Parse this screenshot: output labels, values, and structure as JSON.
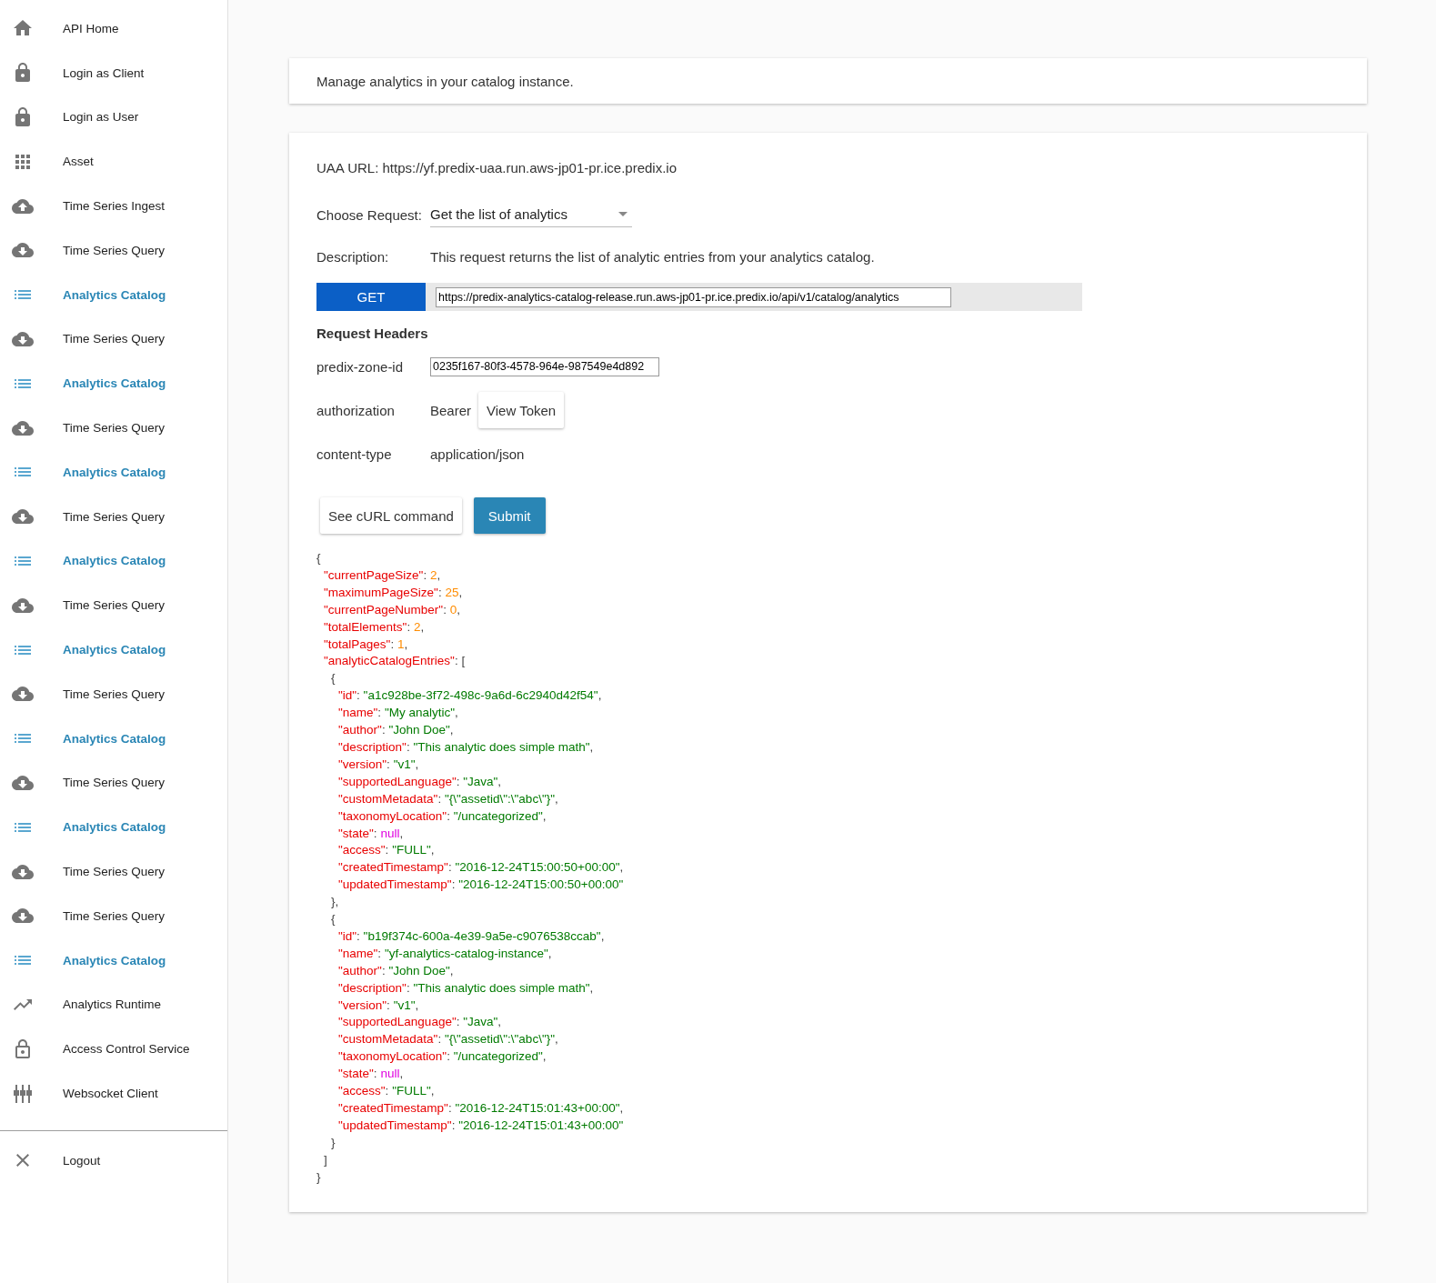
{
  "sidebar": {
    "items": [
      {
        "label": "API Home",
        "kind": "home",
        "selected": false
      },
      {
        "label": "Login as Client",
        "kind": "lock",
        "selected": false
      },
      {
        "label": "Login as User",
        "kind": "lock",
        "selected": false
      },
      {
        "label": "Asset",
        "kind": "grid",
        "selected": false
      },
      {
        "label": "Time Series Ingest",
        "kind": "upload",
        "selected": false
      },
      {
        "label": "Time Series Query",
        "kind": "download",
        "selected": false
      },
      {
        "label": "Analytics Catalog",
        "kind": "list",
        "selected": true
      },
      {
        "label": "Time Series Query",
        "kind": "download",
        "selected": false
      },
      {
        "label": "Analytics Catalog",
        "kind": "list",
        "selected": true
      },
      {
        "label": "Time Series Query",
        "kind": "download",
        "selected": false
      },
      {
        "label": "Analytics Catalog",
        "kind": "list",
        "selected": true
      },
      {
        "label": "Time Series Query",
        "kind": "download",
        "selected": false
      },
      {
        "label": "Analytics Catalog",
        "kind": "list",
        "selected": true
      },
      {
        "label": "Time Series Query",
        "kind": "download",
        "selected": false
      },
      {
        "label": "Analytics Catalog",
        "kind": "list",
        "selected": true
      },
      {
        "label": "Time Series Query",
        "kind": "download",
        "selected": false
      },
      {
        "label": "Analytics Catalog",
        "kind": "list",
        "selected": true
      },
      {
        "label": "Time Series Query",
        "kind": "download",
        "selected": false
      },
      {
        "label": "Analytics Catalog",
        "kind": "list",
        "selected": true
      },
      {
        "label": "Time Series Query",
        "kind": "download",
        "selected": false
      },
      {
        "label": "Time Series Query",
        "kind": "download",
        "selected": false
      },
      {
        "label": "Analytics Catalog",
        "kind": "list",
        "selected": true
      },
      {
        "label": "Analytics Runtime",
        "kind": "trend",
        "selected": false
      },
      {
        "label": "Access Control Service",
        "kind": "lock-outline",
        "selected": false
      },
      {
        "label": "Websocket Client",
        "kind": "sliders",
        "selected": false
      }
    ],
    "footer": [
      {
        "label": "Logout",
        "kind": "close",
        "selected": false
      }
    ]
  },
  "intro": "Manage analytics in your catalog instance.",
  "request": {
    "uaa_url": "UAA URL: https://yf.predix-uaa.run.aws-jp01-pr.ice.predix.io",
    "choose_label": "Choose Request:",
    "choose_value": "Get the list of analytics",
    "description_label": "Description:",
    "description": "This request returns the list of analytic entries from your analytics catalog.",
    "method": "GET",
    "url": "https://predix-analytics-catalog-release.run.aws-jp01-pr.ice.predix.io/api/v1/catalog/analytics",
    "headers_title": "Request Headers",
    "headers": [
      {
        "name": "predix-zone-id",
        "kind": "input",
        "value": "0235f167-80f3-4578-964e-987549e4d892"
      },
      {
        "name": "authorization",
        "kind": "token",
        "value": "Bearer",
        "button": "View Token"
      },
      {
        "name": "content-type",
        "kind": "text",
        "value": "application/json"
      }
    ],
    "buttons": [
      {
        "label": "See cURL command",
        "kind": "plain"
      },
      {
        "label": "Submit",
        "kind": "primary"
      }
    ]
  },
  "response": [
    {
      "tokens": [
        {
          "kind": "punct",
          "text": "{"
        }
      ],
      "children": [
        {
          "tokens": [
            {
              "kind": "key",
              "text": "\"currentPageSize\""
            },
            {
              "kind": "punct",
              "text": ": "
            },
            {
              "kind": "number",
              "text": "2"
            },
            {
              "kind": "punct",
              "text": ","
            }
          ]
        },
        {
          "tokens": [
            {
              "kind": "key",
              "text": "\"maximumPageSize\""
            },
            {
              "kind": "punct",
              "text": ": "
            },
            {
              "kind": "number",
              "text": "25"
            },
            {
              "kind": "punct",
              "text": ","
            }
          ]
        },
        {
          "tokens": [
            {
              "kind": "key",
              "text": "\"currentPageNumber\""
            },
            {
              "kind": "punct",
              "text": ": "
            },
            {
              "kind": "number",
              "text": "0"
            },
            {
              "kind": "punct",
              "text": ","
            }
          ]
        },
        {
          "tokens": [
            {
              "kind": "key",
              "text": "\"totalElements\""
            },
            {
              "kind": "punct",
              "text": ": "
            },
            {
              "kind": "number",
              "text": "2"
            },
            {
              "kind": "punct",
              "text": ","
            }
          ]
        },
        {
          "tokens": [
            {
              "kind": "key",
              "text": "\"totalPages\""
            },
            {
              "kind": "punct",
              "text": ": "
            },
            {
              "kind": "number",
              "text": "1"
            },
            {
              "kind": "punct",
              "text": ","
            }
          ]
        },
        {
          "tokens": [
            {
              "kind": "key",
              "text": "\"analyticCatalogEntries\""
            },
            {
              "kind": "punct",
              "text": ": ["
            }
          ],
          "children": [
            {
              "tokens": [
                {
                  "kind": "punct",
                  "text": "{"
                }
              ],
              "children": [
                {
                  "tokens": [
                    {
                      "kind": "key",
                      "text": "\"id\""
                    },
                    {
                      "kind": "punct",
                      "text": ": "
                    },
                    {
                      "kind": "string",
                      "text": "\"a1c928be-3f72-498c-9a6d-6c2940d42f54\""
                    },
                    {
                      "kind": "punct",
                      "text": ","
                    }
                  ]
                },
                {
                  "tokens": [
                    {
                      "kind": "key",
                      "text": "\"name\""
                    },
                    {
                      "kind": "punct",
                      "text": ": "
                    },
                    {
                      "kind": "string",
                      "text": "\"My analytic\""
                    },
                    {
                      "kind": "punct",
                      "text": ","
                    }
                  ]
                },
                {
                  "tokens": [
                    {
                      "kind": "key",
                      "text": "\"author\""
                    },
                    {
                      "kind": "punct",
                      "text": ": "
                    },
                    {
                      "kind": "string",
                      "text": "\"John Doe\""
                    },
                    {
                      "kind": "punct",
                      "text": ","
                    }
                  ]
                },
                {
                  "tokens": [
                    {
                      "kind": "key",
                      "text": "\"description\""
                    },
                    {
                      "kind": "punct",
                      "text": ": "
                    },
                    {
                      "kind": "string",
                      "text": "\"This analytic does simple math\""
                    },
                    {
                      "kind": "punct",
                      "text": ","
                    }
                  ]
                },
                {
                  "tokens": [
                    {
                      "kind": "key",
                      "text": "\"version\""
                    },
                    {
                      "kind": "punct",
                      "text": ": "
                    },
                    {
                      "kind": "string",
                      "text": "\"v1\""
                    },
                    {
                      "kind": "punct",
                      "text": ","
                    }
                  ]
                },
                {
                  "tokens": [
                    {
                      "kind": "key",
                      "text": "\"supportedLanguage\""
                    },
                    {
                      "kind": "punct",
                      "text": ": "
                    },
                    {
                      "kind": "string",
                      "text": "\"Java\""
                    },
                    {
                      "kind": "punct",
                      "text": ","
                    }
                  ]
                },
                {
                  "tokens": [
                    {
                      "kind": "key",
                      "text": "\"customMetadata\""
                    },
                    {
                      "kind": "punct",
                      "text": ": "
                    },
                    {
                      "kind": "string",
                      "text": "\"{\\\"assetid\\\":\\\"abc\\\"}\""
                    },
                    {
                      "kind": "punct",
                      "text": ","
                    }
                  ]
                },
                {
                  "tokens": [
                    {
                      "kind": "key",
                      "text": "\"taxonomyLocation\""
                    },
                    {
                      "kind": "punct",
                      "text": ": "
                    },
                    {
                      "kind": "string",
                      "text": "\"/uncategorized\""
                    },
                    {
                      "kind": "punct",
                      "text": ","
                    }
                  ]
                },
                {
                  "tokens": [
                    {
                      "kind": "key",
                      "text": "\"state\""
                    },
                    {
                      "kind": "punct",
                      "text": ": "
                    },
                    {
                      "kind": "null",
                      "text": "null"
                    },
                    {
                      "kind": "punct",
                      "text": ","
                    }
                  ]
                },
                {
                  "tokens": [
                    {
                      "kind": "key",
                      "text": "\"access\""
                    },
                    {
                      "kind": "punct",
                      "text": ": "
                    },
                    {
                      "kind": "string",
                      "text": "\"FULL\""
                    },
                    {
                      "kind": "punct",
                      "text": ","
                    }
                  ]
                },
                {
                  "tokens": [
                    {
                      "kind": "key",
                      "text": "\"createdTimestamp\""
                    },
                    {
                      "kind": "punct",
                      "text": ": "
                    },
                    {
                      "kind": "string",
                      "text": "\"2016-12-24T15:00:50+00:00\""
                    },
                    {
                      "kind": "punct",
                      "text": ","
                    }
                  ]
                },
                {
                  "tokens": [
                    {
                      "kind": "key",
                      "text": "\"updatedTimestamp\""
                    },
                    {
                      "kind": "punct",
                      "text": ": "
                    },
                    {
                      "kind": "string",
                      "text": "\"2016-12-24T15:00:50+00:00\""
                    }
                  ]
                }
              ]
            },
            {
              "tokens": [
                {
                  "kind": "punct",
                  "text": "},"
                }
              ]
            },
            {
              "tokens": [
                {
                  "kind": "punct",
                  "text": "{"
                }
              ],
              "children": [
                {
                  "tokens": [
                    {
                      "kind": "key",
                      "text": "\"id\""
                    },
                    {
                      "kind": "punct",
                      "text": ": "
                    },
                    {
                      "kind": "string",
                      "text": "\"b19f374c-600a-4e39-9a5e-c9076538ccab\""
                    },
                    {
                      "kind": "punct",
                      "text": ","
                    }
                  ]
                },
                {
                  "tokens": [
                    {
                      "kind": "key",
                      "text": "\"name\""
                    },
                    {
                      "kind": "punct",
                      "text": ": "
                    },
                    {
                      "kind": "string",
                      "text": "\"yf-analytics-catalog-instance\""
                    },
                    {
                      "kind": "punct",
                      "text": ","
                    }
                  ]
                },
                {
                  "tokens": [
                    {
                      "kind": "key",
                      "text": "\"author\""
                    },
                    {
                      "kind": "punct",
                      "text": ": "
                    },
                    {
                      "kind": "string",
                      "text": "\"John Doe\""
                    },
                    {
                      "kind": "punct",
                      "text": ","
                    }
                  ]
                },
                {
                  "tokens": [
                    {
                      "kind": "key",
                      "text": "\"description\""
                    },
                    {
                      "kind": "punct",
                      "text": ": "
                    },
                    {
                      "kind": "string",
                      "text": "\"This analytic does simple math\""
                    },
                    {
                      "kind": "punct",
                      "text": ","
                    }
                  ]
                },
                {
                  "tokens": [
                    {
                      "kind": "key",
                      "text": "\"version\""
                    },
                    {
                      "kind": "punct",
                      "text": ": "
                    },
                    {
                      "kind": "string",
                      "text": "\"v1\""
                    },
                    {
                      "kind": "punct",
                      "text": ","
                    }
                  ]
                },
                {
                  "tokens": [
                    {
                      "kind": "key",
                      "text": "\"supportedLanguage\""
                    },
                    {
                      "kind": "punct",
                      "text": ": "
                    },
                    {
                      "kind": "string",
                      "text": "\"Java\""
                    },
                    {
                      "kind": "punct",
                      "text": ","
                    }
                  ]
                },
                {
                  "tokens": [
                    {
                      "kind": "key",
                      "text": "\"customMetadata\""
                    },
                    {
                      "kind": "punct",
                      "text": ": "
                    },
                    {
                      "kind": "string",
                      "text": "\"{\\\"assetid\\\":\\\"abc\\\"}\""
                    },
                    {
                      "kind": "punct",
                      "text": ","
                    }
                  ]
                },
                {
                  "tokens": [
                    {
                      "kind": "key",
                      "text": "\"taxonomyLocation\""
                    },
                    {
                      "kind": "punct",
                      "text": ": "
                    },
                    {
                      "kind": "string",
                      "text": "\"/uncategorized\""
                    },
                    {
                      "kind": "punct",
                      "text": ","
                    }
                  ]
                },
                {
                  "tokens": [
                    {
                      "kind": "key",
                      "text": "\"state\""
                    },
                    {
                      "kind": "punct",
                      "text": ": "
                    },
                    {
                      "kind": "null",
                      "text": "null"
                    },
                    {
                      "kind": "punct",
                      "text": ","
                    }
                  ]
                },
                {
                  "tokens": [
                    {
                      "kind": "key",
                      "text": "\"access\""
                    },
                    {
                      "kind": "punct",
                      "text": ": "
                    },
                    {
                      "kind": "string",
                      "text": "\"FULL\""
                    },
                    {
                      "kind": "punct",
                      "text": ","
                    }
                  ]
                },
                {
                  "tokens": [
                    {
                      "kind": "key",
                      "text": "\"createdTimestamp\""
                    },
                    {
                      "kind": "punct",
                      "text": ": "
                    },
                    {
                      "kind": "string",
                      "text": "\"2016-12-24T15:01:43+00:00\""
                    },
                    {
                      "kind": "punct",
                      "text": ","
                    }
                  ]
                },
                {
                  "tokens": [
                    {
                      "kind": "key",
                      "text": "\"updatedTimestamp\""
                    },
                    {
                      "kind": "punct",
                      "text": ": "
                    },
                    {
                      "kind": "string",
                      "text": "\"2016-12-24T15:01:43+00:00\""
                    }
                  ]
                }
              ]
            },
            {
              "tokens": [
                {
                  "kind": "punct",
                  "text": "}"
                }
              ]
            }
          ]
        },
        {
          "tokens": [
            {
              "kind": "punct",
              "text": "]"
            }
          ]
        }
      ]
    },
    {
      "tokens": [
        {
          "kind": "punct",
          "text": "}"
        }
      ]
    }
  ]
}
